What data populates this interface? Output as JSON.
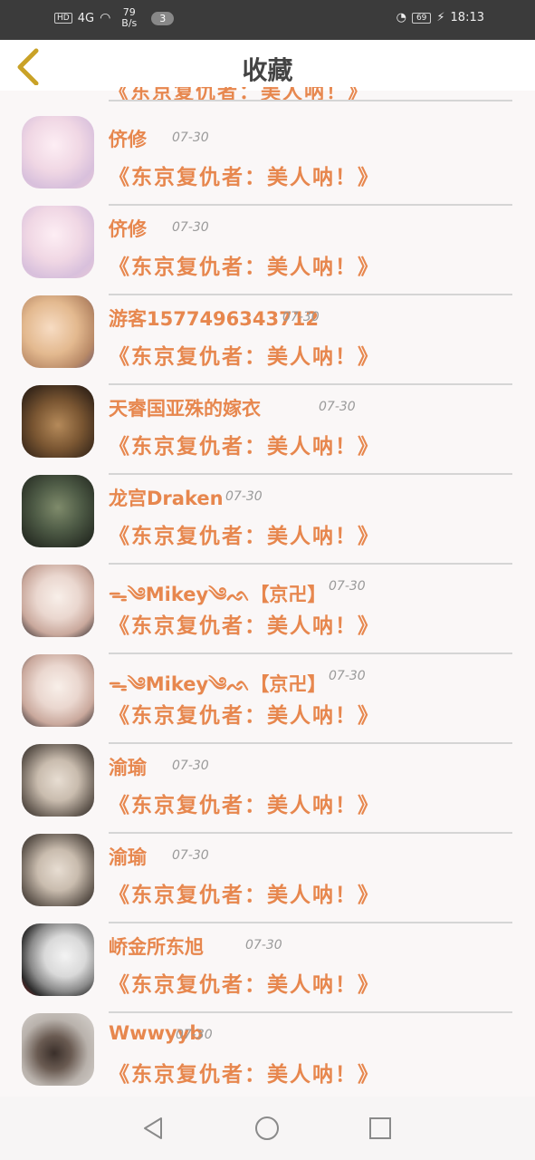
{
  "status": {
    "network": "HD",
    "signal": "4G",
    "speed_value": "79",
    "speed_unit": "B/s",
    "badge": "3",
    "battery": "69",
    "time": "18:13"
  },
  "header": {
    "title": "收藏"
  },
  "partial_item": {
    "work": "《东京复仇者：美人呐！》"
  },
  "items": [
    {
      "name": "侪修",
      "time": "07-30",
      "work": "《东京复仇者：美人呐！》"
    },
    {
      "name": "侪修",
      "time": "07-30",
      "work": "《东京复仇者：美人呐！》"
    },
    {
      "name": "游客1577496343712",
      "time": "07-30",
      "work": "《东京复仇者：美人呐！》"
    },
    {
      "name": "天睿国亚殊的嫁衣",
      "time": "07-30",
      "work": "《东京复仇者：美人呐！》"
    },
    {
      "name": "龙宫Draken",
      "time": "07-30",
      "work": "《东京复仇者：美人呐！》"
    },
    {
      "name": "ᯓ༄Mikey༄ᨒ【京卍】",
      "time": "07-30",
      "work": "《东京复仇者：美人呐！》"
    },
    {
      "name": "ᯓ༄Mikey༄ᨒ【京卍】",
      "time": "07-30",
      "work": "《东京复仇者：美人呐！》"
    },
    {
      "name": "渝瑜",
      "time": "07-30",
      "work": "《东京复仇者：美人呐！》"
    },
    {
      "name": "渝瑜",
      "time": "07-30",
      "work": "《东京复仇者：美人呐！》"
    },
    {
      "name": "峤金所东旭",
      "time": "07-30",
      "work": "《东京复仇者：美人呐！》"
    },
    {
      "name": "Wwwyyb",
      "time": "07-30",
      "work": "《东京复仇者：美人呐！》"
    }
  ],
  "icons": {
    "back": "chevron-left-icon",
    "nav_back": "triangle-back-icon",
    "nav_home": "circle-home-icon",
    "nav_recent": "square-recent-icon"
  },
  "colors": {
    "accent": "#e7874e",
    "back_icon": "#c9a227",
    "title": "#444444"
  }
}
